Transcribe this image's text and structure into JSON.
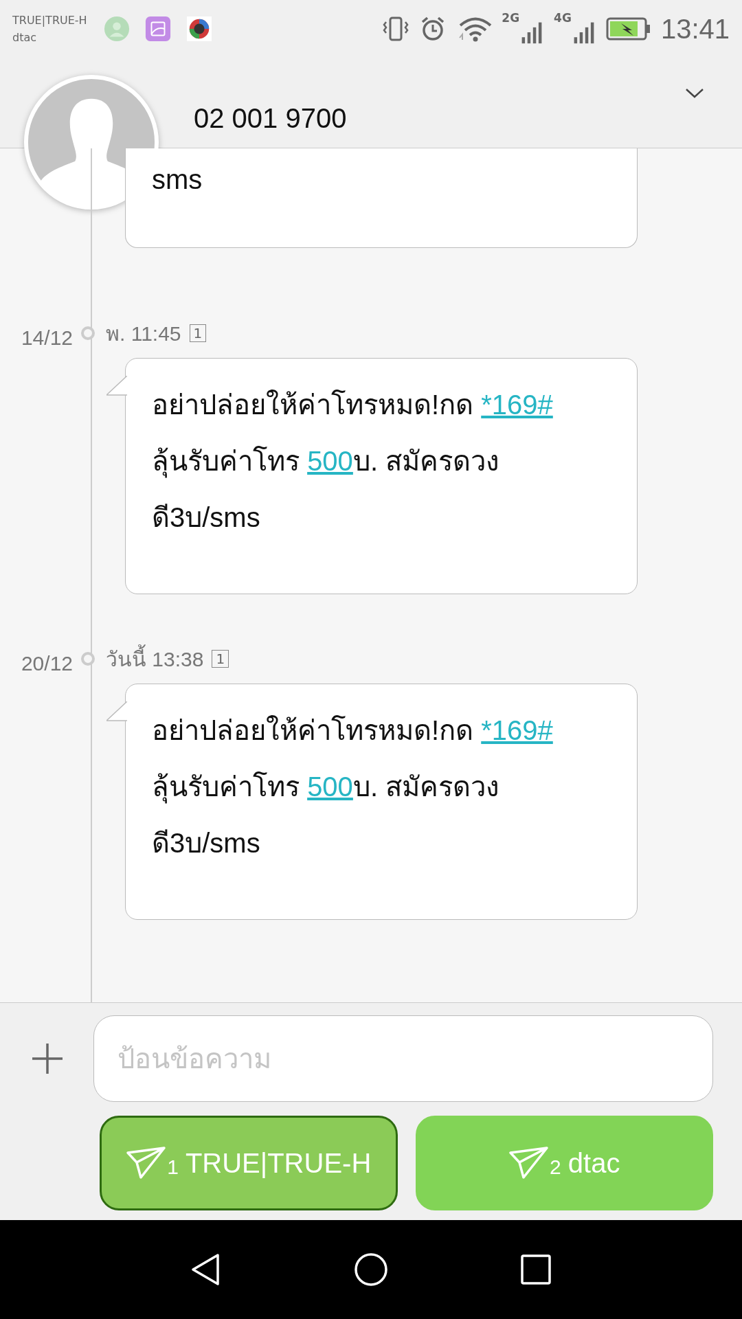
{
  "status_bar": {
    "carriers": [
      "TRUE|TRUE-H",
      "dtac"
    ],
    "network_labels": [
      "2G",
      "4G"
    ],
    "time": "13:41"
  },
  "header": {
    "contact": "02 001 9700"
  },
  "messages": [
    {
      "parts": [
        {
          "text": "sms",
          "link": false
        }
      ],
      "partial": true
    },
    {
      "date": "14/12",
      "time": "พ. 11:45",
      "sim": "1",
      "parts": [
        {
          "text": "อย่าปล่อยให้ค่าโทรหมด!กด ",
          "link": false
        },
        {
          "text": "*169#",
          "link": true
        },
        {
          "text": " ลุ้นรับค่าโทร ",
          "link": false
        },
        {
          "text": "500",
          "link": true
        },
        {
          "text": "บ. สมัครดวงดี3บ/sms",
          "link": false
        }
      ],
      "partial": false
    },
    {
      "date": "20/12",
      "time": "วันนี้ 13:38",
      "sim": "1",
      "parts": [
        {
          "text": "อย่าปล่อยให้ค่าโทรหมด!กด ",
          "link": false
        },
        {
          "text": "*169#",
          "link": true
        },
        {
          "text": " ลุ้นรับค่าโทร ",
          "link": false
        },
        {
          "text": "500",
          "link": true
        },
        {
          "text": "บ. สมัครดวงดี3บ/sms",
          "link": false
        }
      ],
      "partial": false
    }
  ],
  "composer": {
    "placeholder": "ป้อนข้อความ"
  },
  "send_buttons": [
    {
      "number": "1",
      "label": "TRUE|TRUE-H",
      "selected": true
    },
    {
      "number": "2",
      "label": "dtac",
      "selected": false
    }
  ]
}
